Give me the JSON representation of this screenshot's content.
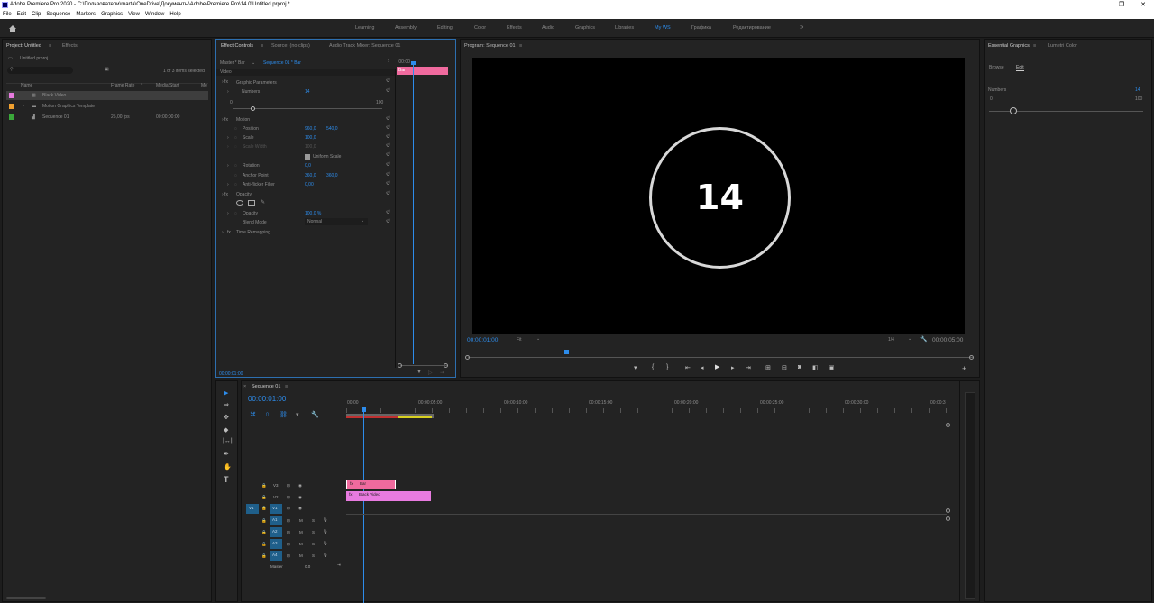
{
  "titlebar": {
    "title": "Adobe Premiere Pro 2020 - C:\\Пользователи\\marta\\OneDrive\\Документы\\Adobe\\Premiere Pro\\14.0\\Untitled.prproj *",
    "min": "—",
    "max": "❐",
    "close": "✕"
  },
  "menu": [
    "File",
    "Edit",
    "Clip",
    "Sequence",
    "Markers",
    "Graphics",
    "View",
    "Window",
    "Help"
  ],
  "workspaces": [
    "Learning",
    "Assembly",
    "Editing",
    "Color",
    "Effects",
    "Audio",
    "Graphics",
    "Libraries",
    "My WS",
    "Графика",
    "Редактирование"
  ],
  "workspace_active": "My WS",
  "project": {
    "tab": "Project: Untitled",
    "tab2": "Effects",
    "file": "Untitled.prproj",
    "search_placeholder": "",
    "count": "1 of 3 items selected",
    "cols": {
      "name": "Name",
      "framerate": "Frame Rate",
      "mediastart": "Media Start",
      "more": "Me"
    },
    "items": [
      {
        "name": "Black Video",
        "fps": "",
        "start": "",
        "color": "#e87be0"
      },
      {
        "name": "Motion Graphics Template",
        "fps": "",
        "start": "",
        "color": "#f0a030"
      },
      {
        "name": "Sequence 01",
        "fps": "25,00 fps",
        "start": "00:00:00:00",
        "color": "#3aa83a"
      }
    ]
  },
  "effects": {
    "tab": "Effect Controls",
    "tab2": "Source: (no clips)",
    "tab3": "Audio Track Mixer: Sequence 01",
    "master": "Master * Bar",
    "seq": "Sequence 01 * Bar",
    "video": "Video",
    "tc_head": ":00:00",
    "clipname": "Bar",
    "graphic_params": "Graphic Parameters",
    "numbers_label": "Numbers",
    "numbers_val": "14",
    "slider_min": "0",
    "slider_max": "100",
    "motion": "Motion",
    "position": "Position",
    "pos_x": "960,0",
    "pos_y": "540,0",
    "scale": "Scale",
    "scale_val": "100,0",
    "scale_width": "Scale Width",
    "scale_width_val": "100,0",
    "uniform": "Uniform Scale",
    "rotation": "Rotation",
    "rotation_val": "0,0",
    "anchor": "Anchor Point",
    "anchor_x": "360,0",
    "anchor_y": "360,0",
    "antiflicker": "Anti-flicker Filter",
    "antiflicker_val": "0,00",
    "opacity_head": "Opacity",
    "opacity": "Opacity",
    "opacity_val": "100,0 %",
    "blend": "Blend Mode",
    "blend_val": "Normal",
    "time_remap": "Time Remapping",
    "timecode": "00:00:01:00"
  },
  "program": {
    "tab": "Program: Sequence 01",
    "number": "14",
    "timecode": "00:00:01:00",
    "fit": "Fit",
    "quality": "1/4",
    "duration": "00:00:05:00"
  },
  "essential": {
    "tab": "Essential Graphics",
    "tab2": "Lumetri Color",
    "browse": "Browse",
    "edit": "Edit",
    "numbers": "Numbers",
    "min": "0",
    "max": "100",
    "val": "14"
  },
  "timeline": {
    "tab": "Sequence 01",
    "timecode": "00:00:01:00",
    "ruler": [
      "00:00",
      "00:00:05:00",
      "00:00:10:00",
      "00:00:15:00",
      "00:00:20:00",
      "00:00:25:00",
      "00:00:30:00",
      "00:00:3"
    ],
    "tracks_v": [
      "V3",
      "V2",
      "V1"
    ],
    "tracks_a": [
      "A1",
      "A2",
      "A3",
      "A4"
    ],
    "src_v": "V1",
    "master": "Master",
    "master_val": "0.0",
    "clip_bar": "Bar",
    "clip_black": "Black Video",
    "m": "M",
    "s": "S"
  },
  "colors": {
    "accent": "#2d8ceb",
    "bar_clip": "#f06a9e",
    "black_clip": "#e87be0"
  }
}
